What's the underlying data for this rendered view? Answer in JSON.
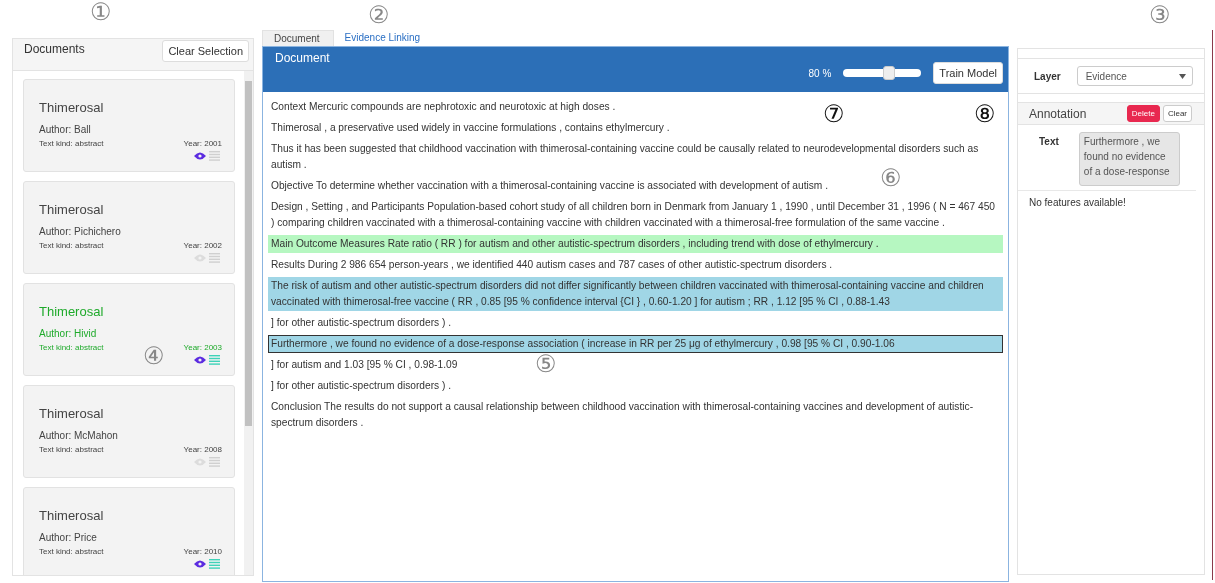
{
  "callouts": [
    {
      "label": "①",
      "dark": false
    },
    {
      "label": "②",
      "dark": false
    },
    {
      "label": "③",
      "dark": false
    },
    {
      "label": "④",
      "dark": false
    },
    {
      "label": "⑤",
      "dark": false
    },
    {
      "label": "⑥",
      "dark": false
    },
    {
      "label": "⑦",
      "dark": true
    },
    {
      "label": "⑧",
      "dark": true
    }
  ],
  "documents_panel": {
    "title": "Documents",
    "clear_button": "Clear Selection",
    "cards": [
      {
        "title": "Thimerosal",
        "author": "Author: Ball",
        "text_kind": "Text kind: abstract",
        "year": "Year: 2001",
        "selected": false,
        "viewed": true,
        "annotated": false
      },
      {
        "title": "Thimerosal",
        "author": "Author: Pichichero",
        "text_kind": "Text kind: abstract",
        "year": "Year: 2002",
        "selected": false,
        "viewed": false,
        "annotated": false
      },
      {
        "title": "Thimerosal",
        "author": "Author: Hivid",
        "text_kind": "Text kind: abstract",
        "year": "Year: 2003",
        "selected": true,
        "viewed": true,
        "annotated": true
      },
      {
        "title": "Thimerosal",
        "author": "Author: McMahon",
        "text_kind": "Text kind: abstract",
        "year": "Year: 2008",
        "selected": false,
        "viewed": false,
        "annotated": false
      },
      {
        "title": "Thimerosal",
        "author": "Author: Price",
        "text_kind": "Text kind: abstract",
        "year": "Year: 2010",
        "selected": false,
        "viewed": true,
        "annotated": true
      }
    ]
  },
  "tabs": [
    {
      "label": "Document",
      "selected": true
    },
    {
      "label": "Evidence Linking",
      "selected": false
    }
  ],
  "document": {
    "title": "Document",
    "zoom_reading": "80 %",
    "level": 0.6,
    "train_button": "Train Model",
    "sentences": [
      {
        "text": "Context Mercuric compounds are nephrotoxic and neurotoxic at high doses .",
        "kind": "plain"
      },
      {
        "text": "Thimerosal , a preservative used widely in vaccine formulations , contains ethylmercury .",
        "kind": "plain"
      },
      {
        "text": "Thus it has been suggested that childhood vaccination with thimerosal-containing vaccine could be causally related to neurodevelopmental disorders such as autism .",
        "kind": "plain"
      },
      {
        "text": "Objective To determine whether vaccination with a thimerosal-containing vaccine is associated with development of autism .",
        "kind": "plain"
      },
      {
        "text": "Design , Setting , and Participants Population-based cohort study of all children born in Denmark from January 1 , 1990 , until December 31 , 1996 ( N = 467 450 ) comparing children vaccinated with a thimerosal-containing vaccine with children vaccinated with a thimerosal-free formulation of the same vaccine .",
        "kind": "plain"
      },
      {
        "text": "Main Outcome Measures Rate ratio ( RR ) for autism and other autistic-spectrum disorders , including trend with dose of ethylmercury .",
        "kind": "green"
      },
      {
        "text": "Results During 2 986 654 person-years , we identified 440 autism cases and 787 cases of other autistic-spectrum disorders .",
        "kind": "plain"
      },
      {
        "text": "The risk of autism and other autistic-spectrum disorders did not differ significantly between children vaccinated with thimerosal-containing vaccine and children vaccinated with thimerosal-free vaccine ( RR , 0.85 [95 % confidence interval {CI } , 0.60-1.20 ] for autism ; RR , 1.12 [95 % CI , 0.88-1.43",
        "kind": "blue"
      },
      {
        "text": "] for other autistic-spectrum disorders ) .",
        "kind": "plain"
      },
      {
        "text": "Furthermore , we found no evidence of a dose-response association ( increase in RR per 25 μg of ethylmercury , 0.98 [95 % CI , 0.90-1.06",
        "kind": "active"
      },
      {
        "text": "] for autism and 1.03 [95 % CI , 0.98-1.09",
        "kind": "plain"
      },
      {
        "text": "] for other autistic-spectrum disorders ) .",
        "kind": "plain"
      },
      {
        "text": "Conclusion The results do not support a causal relationship between childhood vaccination with thimerosal-containing vaccines and development of autistic-spectrum disorders .",
        "kind": "plain"
      }
    ]
  },
  "side_panel": {
    "layer_label": "Layer",
    "layer_value": "Evidence",
    "annotation_title": "Annotation",
    "delete_button": "Delete",
    "clear_button": "Clear",
    "text_label": "Text",
    "text_value": "Furthermore , we found no evidence of a dose-response",
    "features_message": "No features available!"
  }
}
